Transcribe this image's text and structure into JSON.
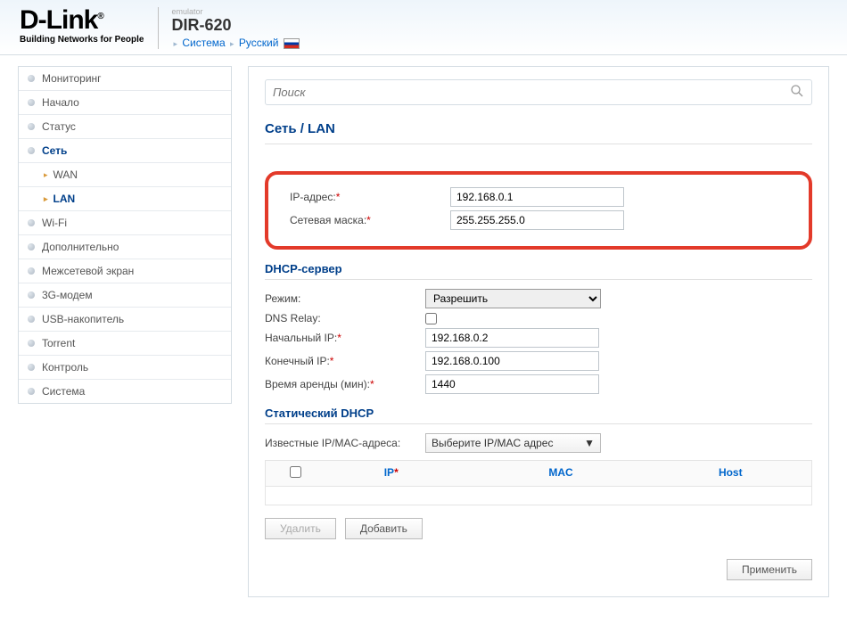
{
  "logo": {
    "brand": "D-Link",
    "tagline": "Building Networks for People"
  },
  "header": {
    "emulator": "emulator",
    "model": "DIR-620",
    "crumb1": "Система",
    "crumb2": "Русский"
  },
  "search": {
    "placeholder": "Поиск"
  },
  "sidebar": {
    "items": [
      {
        "label": "Мониторинг"
      },
      {
        "label": "Начало"
      },
      {
        "label": "Статус"
      },
      {
        "label": "Сеть"
      },
      {
        "label": "WAN"
      },
      {
        "label": "LAN"
      },
      {
        "label": "Wi-Fi"
      },
      {
        "label": "Дополнительно"
      },
      {
        "label": "Межсетевой экран"
      },
      {
        "label": "3G-модем"
      },
      {
        "label": "USB-накопитель"
      },
      {
        "label": "Torrent"
      },
      {
        "label": "Контроль"
      },
      {
        "label": "Система"
      }
    ]
  },
  "page": {
    "title": "Сеть  /  LAN"
  },
  "ip_section": {
    "ip_label": "IP-адрес:",
    "ip_value": "192.168.0.1",
    "mask_label": "Сетевая маска:",
    "mask_value": "255.255.255.0"
  },
  "dhcp": {
    "title": "DHCP-сервер",
    "mode_label": "Режим:",
    "mode_value": "Разрешить",
    "relay_label": "DNS Relay:",
    "start_label": "Начальный IP:",
    "start_value": "192.168.0.2",
    "end_label": "Конечный IP:",
    "end_value": "192.168.0.100",
    "lease_label": "Время аренды (мин):",
    "lease_value": "1440"
  },
  "static": {
    "title": "Статический DHCP",
    "known_label": "Известные IP/MAC-адреса:",
    "known_select": "Выберите IP/MAC адрес",
    "col_ip": "IP",
    "col_mac": "MAC",
    "col_host": "Host"
  },
  "buttons": {
    "delete": "Удалить",
    "add": "Добавить",
    "apply": "Применить"
  }
}
